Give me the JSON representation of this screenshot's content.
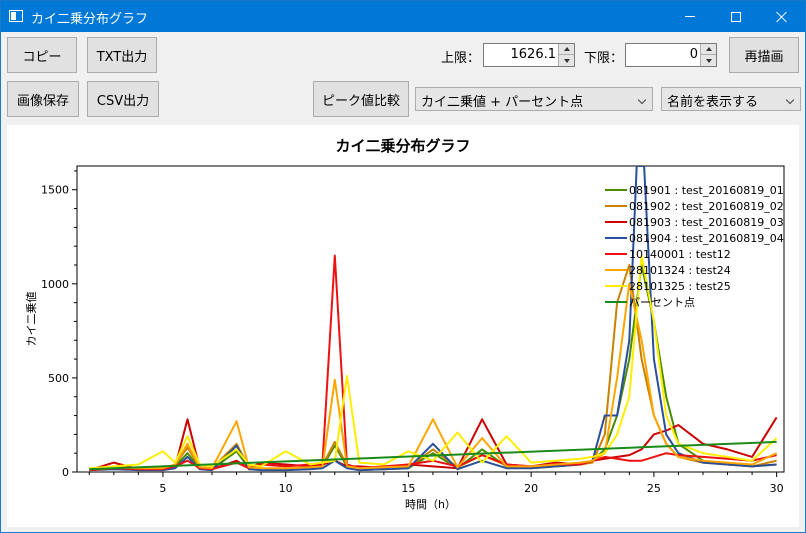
{
  "window": {
    "title": "カイ二乗分布グラフ"
  },
  "toolbar": {
    "copy": "コピー",
    "txt_export": "TXT出力",
    "save_image": "画像保存",
    "csv_export": "CSV出力",
    "peak_compare": "ピーク値比較",
    "redraw": "再描画",
    "upper_label": "上限：",
    "upper_value": "1626.1",
    "lower_label": "下限：",
    "lower_value": "0",
    "mode_select": "カイ二乗値 + パーセント点",
    "name_select": "名前を表示する"
  },
  "chart_data": {
    "type": "line",
    "title": "カイ二乗分布グラフ",
    "xlabel": "時間（h）",
    "ylabel": "カイ二乗値",
    "xlim": [
      1.5,
      30.3
    ],
    "ylim": [
      0,
      1626.1
    ],
    "xticks": [
      5,
      10,
      15,
      20,
      25,
      30
    ],
    "yticks": [
      0,
      500,
      1000,
      1500
    ],
    "legend": "top-right",
    "grid": false,
    "series": [
      {
        "name": "081901 : test_20160819_01",
        "color": "#4b8b00",
        "x": [
          2,
          3,
          4,
          5,
          5.5,
          6,
          6.5,
          7,
          8,
          8.5,
          9,
          10,
          11,
          11.5,
          12,
          12.5,
          13,
          14,
          15,
          16,
          17,
          18,
          19,
          20,
          21,
          22,
          22.5,
          23,
          23.5,
          24,
          24.5,
          25,
          25.5,
          26,
          27,
          28,
          29,
          30
        ],
        "y": [
          10,
          20,
          15,
          10,
          30,
          100,
          20,
          15,
          110,
          20,
          15,
          10,
          20,
          30,
          140,
          30,
          10,
          15,
          20,
          100,
          20,
          120,
          30,
          20,
          30,
          40,
          60,
          120,
          300,
          600,
          1100,
          800,
          400,
          150,
          60,
          40,
          30,
          40
        ]
      },
      {
        "name": "081902 : test_20160819_02",
        "color": "#c98200",
        "x": [
          2,
          3,
          4,
          5,
          5.5,
          6,
          6.5,
          7,
          8,
          8.5,
          9,
          10,
          11,
          11.5,
          12,
          12.5,
          13,
          14,
          15,
          16,
          17,
          18,
          19,
          20,
          21,
          22,
          22.5,
          23,
          23.5,
          24,
          24.5,
          25,
          25.5,
          26,
          27,
          28,
          29,
          30
        ],
        "y": [
          15,
          25,
          20,
          15,
          40,
          130,
          25,
          20,
          150,
          25,
          20,
          15,
          25,
          35,
          160,
          35,
          15,
          20,
          25,
          120,
          25,
          90,
          35,
          25,
          35,
          40,
          50,
          200,
          900,
          1100,
          600,
          300,
          150,
          80,
          50,
          40,
          30,
          60
        ]
      },
      {
        "name": "081903 : test_20160819_03",
        "color": "#cc0000",
        "x": [
          2,
          3,
          4,
          5,
          5.5,
          6,
          6.5,
          7,
          8,
          8.5,
          9,
          10,
          11,
          11.5,
          12,
          12.5,
          13,
          14,
          15,
          16,
          17,
          18,
          19,
          20,
          21,
          22,
          22.5,
          23,
          23.5,
          24,
          24.5,
          25,
          25.5,
          26,
          27,
          28,
          29,
          30
        ],
        "y": [
          10,
          50,
          15,
          20,
          30,
          280,
          20,
          15,
          60,
          20,
          50,
          40,
          30,
          40,
          60,
          30,
          30,
          20,
          40,
          30,
          20,
          280,
          40,
          30,
          50,
          40,
          60,
          70,
          80,
          90,
          120,
          200,
          220,
          250,
          150,
          120,
          80,
          290
        ]
      },
      {
        "name": "081904 : test_20160819_04",
        "color": "#2a4f9a",
        "x": [
          2,
          3,
          4,
          5,
          5.5,
          6,
          6.5,
          7,
          8,
          8.5,
          9,
          10,
          11,
          11.5,
          12,
          12.5,
          13,
          14,
          15,
          16,
          17,
          18,
          19,
          20,
          21,
          22,
          22.5,
          23,
          23.5,
          24,
          24.3,
          24.6,
          25,
          25.5,
          26,
          27,
          28,
          29,
          30
        ],
        "y": [
          10,
          15,
          10,
          10,
          20,
          80,
          15,
          10,
          140,
          15,
          10,
          10,
          15,
          20,
          60,
          20,
          10,
          15,
          20,
          150,
          15,
          60,
          20,
          20,
          30,
          40,
          60,
          300,
          300,
          700,
          1626.1,
          1626.1,
          600,
          200,
          100,
          50,
          40,
          30,
          40
        ]
      },
      {
        "name": "10140001 : test12",
        "color": "#ee1111",
        "x": [
          2,
          3,
          4,
          5,
          5.5,
          6,
          6.5,
          7,
          8,
          8.5,
          9,
          10,
          11,
          11.5,
          12,
          12.5,
          13,
          14,
          15,
          16,
          17,
          18,
          19,
          20,
          21,
          22,
          22.5,
          23,
          23.5,
          24,
          24.5,
          25,
          25.5,
          26,
          27,
          28,
          29,
          30
        ],
        "y": [
          10,
          20,
          15,
          15,
          30,
          60,
          20,
          15,
          50,
          20,
          40,
          30,
          40,
          50,
          1150,
          40,
          20,
          30,
          40,
          60,
          30,
          90,
          40,
          30,
          40,
          40,
          60,
          80,
          70,
          60,
          60,
          80,
          100,
          90,
          80,
          70,
          60,
          90
        ]
      },
      {
        "name": "28101324 : test24",
        "color": "#ffa500",
        "x": [
          2,
          3,
          4,
          5,
          5.5,
          6,
          6.5,
          7,
          8,
          8.5,
          9,
          10,
          11,
          11.5,
          12,
          12.5,
          13,
          14,
          15,
          16,
          17,
          18,
          19,
          20,
          21,
          22,
          22.5,
          23,
          23.5,
          24,
          24.5,
          25,
          25.5,
          26,
          27,
          28,
          29,
          30
        ],
        "y": [
          15,
          25,
          20,
          20,
          40,
          150,
          25,
          20,
          270,
          25,
          20,
          20,
          25,
          30,
          490,
          30,
          20,
          25,
          30,
          280,
          25,
          180,
          30,
          30,
          40,
          50,
          60,
          100,
          500,
          1000,
          700,
          300,
          150,
          80,
          60,
          50,
          40,
          100
        ]
      },
      {
        "name": "28101325 : test25",
        "color": "#ffee00",
        "x": [
          2,
          3,
          4,
          5,
          5.5,
          6,
          6.5,
          7,
          8,
          8.5,
          9,
          10,
          11,
          11.5,
          12,
          12.5,
          13,
          14,
          15,
          16,
          17,
          18,
          19,
          20,
          21,
          22,
          22.5,
          23,
          23.5,
          24,
          24.5,
          25,
          25.5,
          26,
          27,
          28,
          29,
          30
        ],
        "y": [
          20,
          30,
          40,
          110,
          50,
          190,
          40,
          30,
          120,
          40,
          30,
          110,
          40,
          50,
          60,
          510,
          50,
          40,
          110,
          60,
          210,
          50,
          190,
          50,
          60,
          70,
          80,
          100,
          200,
          400,
          1150,
          800,
          300,
          150,
          100,
          80,
          60,
          180
        ]
      },
      {
        "name": "パーセント点",
        "color": "#1a8a1a",
        "x": [
          2,
          30
        ],
        "y": [
          15,
          160
        ]
      }
    ]
  }
}
